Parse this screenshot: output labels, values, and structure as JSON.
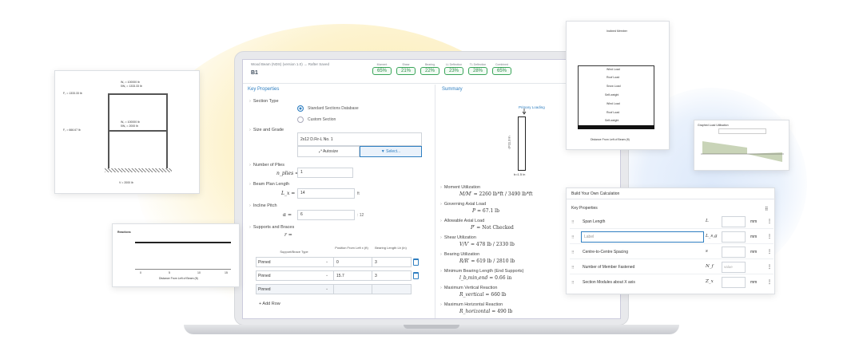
{
  "frame_card": {
    "w_top": "W꜀ = 100000 lb",
    "dw_top": "δW꜀ = 1333.33 lb",
    "f_top": "F꜀ = 1333.33 lb",
    "w_mid": "W꜀ = 100000 lb",
    "dw_mid": "δW꜀ = 2000 lb",
    "f_mid": "F꜀ = 666.67 lb",
    "v_bottom": "V = 2000 lb"
  },
  "app": {
    "breadcrumb": "Wood Beam (NDS) (version 1.0)  →  Rafter     Saved",
    "beam_name": "B1",
    "utilizations": [
      {
        "label": "Moment",
        "value": "65%"
      },
      {
        "label": "Shear",
        "value": "21%"
      },
      {
        "label": "Bearing",
        "value": "22%"
      },
      {
        "label": "LL Deflection",
        "value": "23%"
      },
      {
        "label": "TL Deflection",
        "value": "28%"
      },
      {
        "label": "Combined",
        "value": "65%"
      }
    ],
    "key_properties_title": "Key Properties",
    "summary_title": "Summary",
    "section_type_label": "Section Type",
    "radio_standard": "Standard Sections Database",
    "radio_custom": "Custom Section",
    "size_grade_label": "Size and Grade",
    "size_value": "2x12 D.Fir-L No. 1",
    "autosize_button": "Autosize",
    "select_button": "Select...",
    "plies_label": "Number of Plies",
    "plies_symbol": "n_plies =",
    "plies_value": "1",
    "span_label": "Beam Plan Length",
    "span_symbol": "L_x =",
    "span_value": "14",
    "span_unit": "ft",
    "pitch_label": "Incline Pitch",
    "pitch_symbol": "α =",
    "pitch_value": "6",
    "pitch_unit": ": 12",
    "supports_label": "Supports and Braces",
    "supports_symbol": "r =",
    "table_headers": [
      "Support/Brace Type",
      "Position From Left x (ft)",
      "Bearing Length Lb (in)"
    ],
    "support_rows": [
      {
        "type": "Pinned",
        "position": "0",
        "bearing": "3"
      },
      {
        "type": "Pinned",
        "position": "15.7",
        "bearing": "3"
      },
      {
        "type": "Pinned",
        "position": "",
        "bearing": ""
      }
    ],
    "add_row": "+ Add Row",
    "primary_loading": "Primary Loading",
    "dim_d": "d=11.3 in",
    "dim_b": "b=1.5 in",
    "results": [
      {
        "label": "Moment Utilization",
        "eq": "M/M′ =",
        "value": "2260 lb*ft / 3490 lb*ft"
      },
      {
        "label": "Governing Axial Load",
        "eq": "P =",
        "value": "67.1 lb"
      },
      {
        "label": "Allowable Axial Load",
        "eq": "P′ =",
        "value": "Not Checked"
      },
      {
        "label": "Shear Utilization",
        "eq": "V/V′ =",
        "value": "478 lb / 2330 lb"
      },
      {
        "label": "Bearing Utilization",
        "eq": "R/R′ =",
        "value": "619 lb / 2810 lb"
      },
      {
        "label": "Minimum Bearing Length (End Supports)",
        "eq": "l_b,min,end =",
        "value": "0.66 in"
      },
      {
        "label": "Maximum Vertical Reaction",
        "eq": "R_vertical =",
        "value": "660 lb"
      },
      {
        "label": "Maximum Horizontal Reaction",
        "eq": "R_horizontal =",
        "value": "490 lb"
      }
    ]
  },
  "reactions_card": {
    "title": "Reactions",
    "axis_label": "Distance From Left of Beam (ft)",
    "ticks": [
      "0",
      "5",
      "10",
      "15"
    ]
  },
  "loads_card": {
    "title": "Inclined Member",
    "rows": [
      "Wind Load",
      "Roof Load",
      "Snow Load",
      "Self-weight",
      "Wind Load",
      "Roof Load",
      "Self-weight"
    ],
    "axis_label": "Distance From Left of Beam (ft)"
  },
  "graph_card": {
    "title": "Graphed Load Utilisation"
  },
  "build": {
    "title": "Build Your Own Calculation",
    "section": "Key Properties",
    "rows": [
      {
        "name": "Span Length",
        "symbol": "L",
        "placeholder": "",
        "unit": "mm"
      },
      {
        "name": "Label",
        "symbol": "L_s,g",
        "placeholder": "",
        "unit": "mm"
      },
      {
        "name": "Centre-to-Centre Spacing",
        "symbol": "s",
        "placeholder": "",
        "unit": "mm"
      },
      {
        "name": "Number of Member Fastened",
        "symbol": "N_f",
        "placeholder": "value",
        "unit": ""
      },
      {
        "name": "Section Modules about X axis",
        "symbol": "Z_x",
        "placeholder": "",
        "unit": "mm"
      }
    ]
  }
}
